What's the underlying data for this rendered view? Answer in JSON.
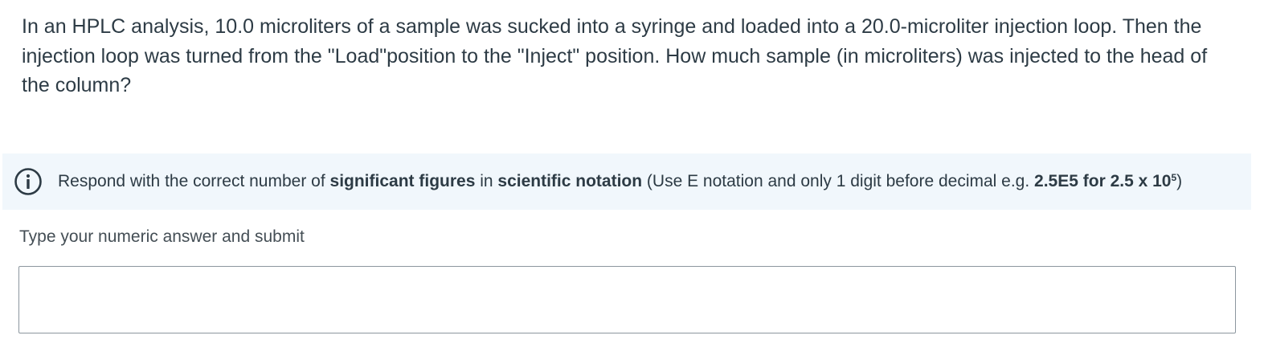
{
  "question": {
    "text": "In an HPLC analysis, 10.0 microliters of a sample was sucked into a syringe and loaded into a 20.0-microliter injection loop. Then the injection loop was turned from the \"Load\"position to the \"Inject\" position. How much sample (in microliters) was injected to the head of the column?"
  },
  "notice": {
    "icon": "info-icon",
    "part1": "Respond with the correct number of ",
    "bold1": "significant figures",
    "part2": " in ",
    "bold2": "scientific notation",
    "part3": " (Use E notation and only 1 digit before decimal e.g. ",
    "bold3": "2.5E5 for 2.5 x 10",
    "bold3_sup": "5",
    "part4": ")"
  },
  "answer": {
    "label": "Type your numeric answer and submit",
    "value": ""
  },
  "colors": {
    "text": "#2d3b45",
    "notice_bg": "#f1f7fc",
    "input_border": "#8c969e"
  }
}
